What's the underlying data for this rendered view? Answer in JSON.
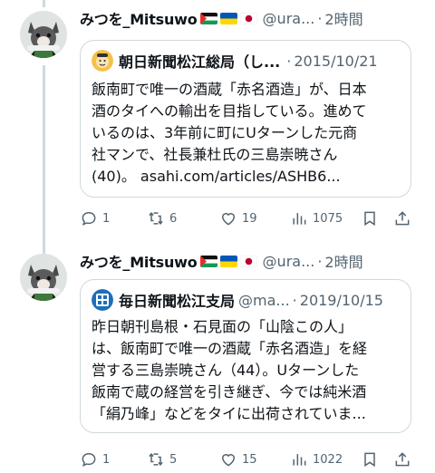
{
  "tweets": [
    {
      "author_name": "みつを_Mitsuwo",
      "handle": "@ura...",
      "separator": "·",
      "time": "2時間",
      "quote": {
        "name": "朝日新聞松江総局（し...",
        "handle": "",
        "separator": "·",
        "date": "2015/10/21",
        "lines": [
          "飯南町で唯一の酒蔵「赤名酒造」が、日本",
          "酒のタイへの輸出を目指している。進めて",
          "いるのは、3年前に町にUターンした元商",
          "社マンで、社長兼杜氏の三島崇暁さん",
          "(40)。 asahi.com/articles/ASHB6..."
        ]
      },
      "actions": {
        "reply": "1",
        "retweet": "6",
        "like": "19",
        "views": "1075"
      }
    },
    {
      "author_name": "みつを_Mitsuwo",
      "handle": "@ura...",
      "separator": "·",
      "time": "2時間",
      "quote": {
        "name": "毎日新聞松江支局",
        "handle": "@ma...",
        "separator": "·",
        "date": "2019/10/15",
        "lines": [
          "昨日朝刊島根・石見面の「山陰この人」",
          "は、飯南町で唯一の酒蔵「赤名酒造」を経",
          "営する三島崇暁さん（44）。Uターンした",
          "飯南で蔵の経営を引き継ぎ、今では純米酒",
          "「絹乃峰」などをタイに出荷されていま..."
        ]
      },
      "actions": {
        "reply": "1",
        "retweet": "5",
        "like": "15",
        "views": "1022"
      }
    }
  ],
  "icons": {
    "reply": "reply-icon",
    "retweet": "retweet-icon",
    "like": "heart-icon",
    "views": "views-icon",
    "bookmark": "bookmark-icon",
    "share": "share-icon",
    "flags": [
      "palestine-flag-icon",
      "ukraine-flag-icon",
      "japan-flag-icon"
    ]
  },
  "colors": {
    "text": "#0f1419",
    "secondary": "#536471",
    "border": "#cfd9de",
    "mainichi_blue": "#1d6fb8"
  }
}
